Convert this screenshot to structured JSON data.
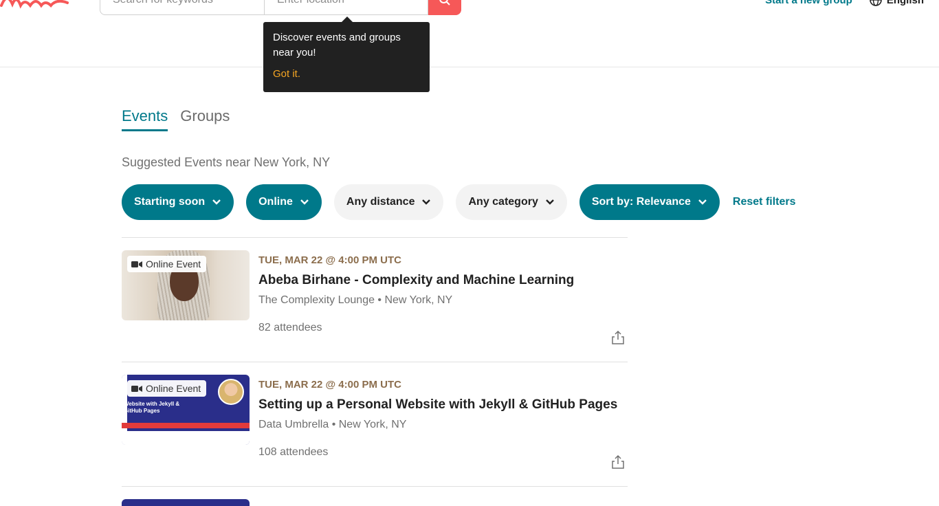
{
  "header": {
    "search_placeholder": "Search for keywords",
    "location_placeholder": "Enter location",
    "start_group": "Start a new group",
    "language": "English"
  },
  "tooltip": {
    "message": "Discover events and groups near you!",
    "action": "Got it."
  },
  "tabs": [
    {
      "label": "Events",
      "active": true
    },
    {
      "label": "Groups",
      "active": false
    }
  ],
  "subtitle": "Suggested Events near New York, NY",
  "filters": [
    {
      "label": "Starting soon",
      "active": true
    },
    {
      "label": "Online",
      "active": true
    },
    {
      "label": "Any distance",
      "active": false
    },
    {
      "label": "Any category",
      "active": false
    },
    {
      "label": "Sort by: Relevance",
      "active": true
    }
  ],
  "reset_filters": "Reset filters",
  "events": [
    {
      "badge": "Online Event",
      "date": "TUE, MAR 22 @ 4:00 PM UTC",
      "title": "Abeba Birhane - Complexity and Machine Learning",
      "group": "The Complexity Lounge • New York, NY",
      "attendees": "82 attendees"
    },
    {
      "badge": "Online Event",
      "date": "TUE, MAR 22 @ 4:00 PM UTC",
      "title": "Setting up a Personal Website with Jekyll & GitHub Pages",
      "group": "Data Umbrella • New York, NY",
      "attendees": "108 attendees",
      "thumb_text": "Website with Jekyll & GitHub Pages"
    }
  ],
  "colors": {
    "brand_teal": "#00798a",
    "search_red": "#f65858",
    "date_brown": "#8b6d4c",
    "tooltip_bg": "#212121",
    "tooltip_action": "#f6a623"
  }
}
